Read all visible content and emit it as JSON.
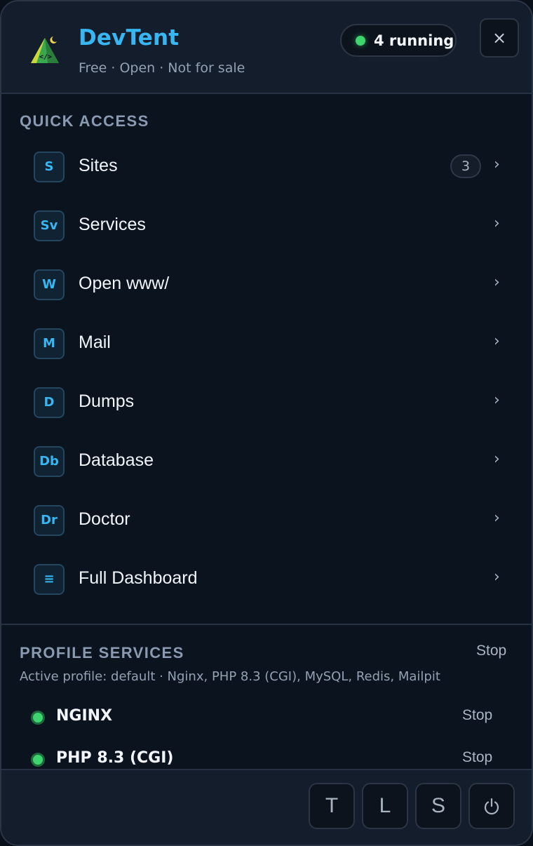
{
  "header": {
    "title": "DevTent",
    "subtitle": "Free · Open · Not for sale",
    "status": {
      "text": "4 running",
      "color": "#3ed56e"
    },
    "close_icon": "×",
    "accent": "#38b6f2"
  },
  "quick_access": {
    "label": "QUICK ACCESS",
    "items": [
      {
        "badge": "S",
        "label": "Sites",
        "count": "3"
      },
      {
        "badge": "Sv",
        "label": "Services"
      },
      {
        "badge": "W",
        "label": "Open www/"
      },
      {
        "badge": "M",
        "label": "Mail"
      },
      {
        "badge": "D",
        "label": "Dumps"
      },
      {
        "badge": "Db",
        "label": "Database"
      },
      {
        "badge": "Dr",
        "label": "Doctor"
      },
      {
        "badge": "≡",
        "label": "Full Dashboard"
      }
    ],
    "chevron": "›"
  },
  "profile": {
    "label": "PROFILE SERVICES",
    "stop_label": "Stop",
    "description": "Active profile: default · Nginx, PHP 8.3 (CGI), MySQL, Redis, Mailpit",
    "services": [
      {
        "name": "NGINX",
        "action": "Stop",
        "status": "running"
      },
      {
        "name": "PHP 8.3 (CGI)",
        "action": "Stop",
        "status": "running"
      }
    ]
  },
  "footer": {
    "buttons": [
      {
        "label": "T"
      },
      {
        "label": "L"
      },
      {
        "label": "S"
      },
      {
        "label": "⏻",
        "icon": "power-icon"
      }
    ]
  }
}
